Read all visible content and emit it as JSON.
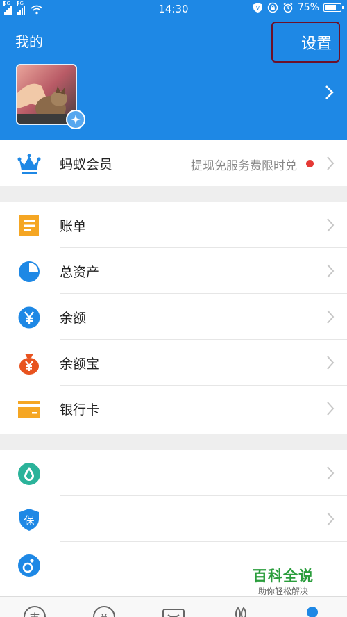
{
  "status_bar": {
    "network_1": "2G",
    "network_2": "4G",
    "time": "14:30",
    "battery": "75%",
    "battery_level": 0.75
  },
  "header": {
    "title": "我的",
    "settings_label": "设置"
  },
  "membership": {
    "label": "蚂蚁会员",
    "promo": "提现免服务费限时兑"
  },
  "finance_items": [
    {
      "label": "账单",
      "icon": "bill-icon"
    },
    {
      "label": "总资产",
      "icon": "pie-chart-icon"
    },
    {
      "label": "余额",
      "icon": "yuan-icon"
    },
    {
      "label": "余额宝",
      "icon": "money-bag-icon"
    },
    {
      "label": "银行卡",
      "icon": "bank-card-icon"
    }
  ],
  "service_items": [
    {
      "label": "",
      "icon": "water-drop-icon"
    },
    {
      "label": "保",
      "icon": "insurance-shield-icon"
    },
    {
      "label": "",
      "icon": "ant-icon"
    }
  ],
  "watermark": {
    "title": "百科全说",
    "subtitle": "助你轻松解决"
  },
  "tabbar": {
    "tab_1_glyph": "支",
    "tab_2_glyph": "¥"
  },
  "colors": {
    "brand_blue": "#1e88e5",
    "orange": "#f5a623",
    "red_orange": "#e8531f",
    "icon_blue": "#1e88e5",
    "teal": "#2bb39a"
  }
}
